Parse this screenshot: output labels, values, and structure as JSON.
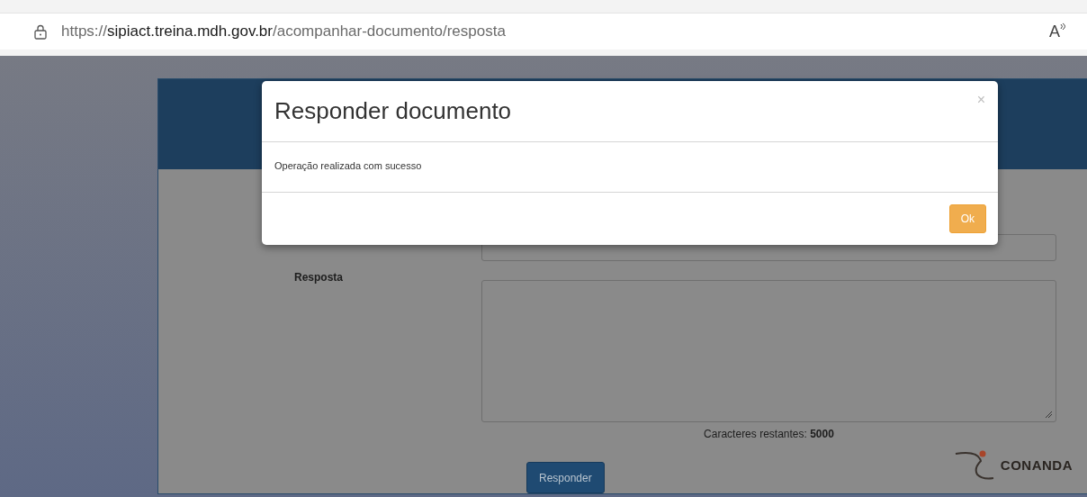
{
  "browser": {
    "url_scheme": "https://",
    "url_host": "sipiact.treina.mdh.gov.br",
    "url_path": "/acompanhar-documento/resposta",
    "read_aloud": "A"
  },
  "form": {
    "label": "Resposta",
    "counter_label": "Caracteres restantes: ",
    "counter_value": "5000",
    "submit": "Responder",
    "logo": "CONANDA"
  },
  "modal": {
    "title": "Responder documento",
    "close": "×",
    "message": "Operação realizada com sucesso",
    "ok": "Ok"
  }
}
